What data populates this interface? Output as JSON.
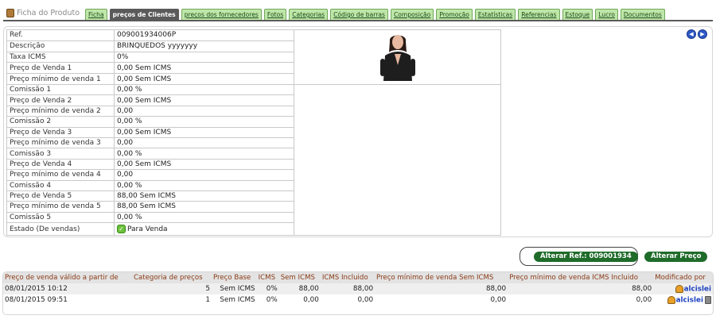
{
  "tabs": {
    "title": "Ficha do Produto",
    "items": [
      {
        "label": "Ficha",
        "active": false
      },
      {
        "label": "preços de Clientes",
        "active": true
      },
      {
        "label": "preços dos fornecedores",
        "active": false
      },
      {
        "label": "Fotos",
        "active": false
      },
      {
        "label": "Categorias",
        "active": false
      },
      {
        "label": "Código de barras",
        "active": false
      },
      {
        "label": "Composição",
        "active": false
      },
      {
        "label": "Promoção",
        "active": false
      },
      {
        "label": "Estatísticas",
        "active": false
      },
      {
        "label": "Referencias",
        "active": false
      },
      {
        "label": "Estoque",
        "active": false
      },
      {
        "label": "Lucro",
        "active": false
      },
      {
        "label": "Documentos",
        "active": false
      }
    ]
  },
  "product": {
    "rows": [
      {
        "label": "Ref.",
        "value": "009001934006P"
      },
      {
        "label": "Descrição",
        "value": "BRINQUEDOS yyyyyyy"
      },
      {
        "label": "Taxa ICMS",
        "value": "0%"
      },
      {
        "label": "Preço de Venda 1",
        "value": "0,00 Sem ICMS"
      },
      {
        "label": "Preço mínimo de venda 1",
        "value": "0,00 Sem ICMS"
      },
      {
        "label": "Comissão 1",
        "value": "0,00 %"
      },
      {
        "label": "Preço de Venda 2",
        "value": "0,00 Sem ICMS"
      },
      {
        "label": "Preço mínimo de venda 2",
        "value": "0,00"
      },
      {
        "label": "Comissão 2",
        "value": "0,00 %"
      },
      {
        "label": "Preço de Venda 3",
        "value": "0,00 Sem ICMS"
      },
      {
        "label": "Preço mínimo de venda 3",
        "value": "0,00"
      },
      {
        "label": "Comissão 3",
        "value": "0,00 %"
      },
      {
        "label": "Preço de Venda 4",
        "value": "0,00 Sem ICMS"
      },
      {
        "label": "Preço mínimo de venda 4",
        "value": "0,00"
      },
      {
        "label": "Comissão 4",
        "value": "0,00 %"
      },
      {
        "label": "Preço de Venda 5",
        "value": "88,00 Sem ICMS"
      },
      {
        "label": "Preço mínimo de venda 5",
        "value": "88,00 Sem ICMS"
      },
      {
        "label": "Comissão 5",
        "value": "0,00 %"
      }
    ],
    "status_label": "Estado (De vendas)",
    "status_value": "Para Venda"
  },
  "actions": {
    "alter_ref": "Alterar Ref.: 009001934",
    "alter_price": "Alterar Preço"
  },
  "prices": {
    "headers": [
      "Preço de venda válido a partir de",
      "Categoria de preços",
      "Preço Base",
      "ICMS",
      "Sem ICMS",
      "ICMS Incluido",
      "Preço mínimo de venda Sem ICMS",
      "Preço mínimo de venda ICMS Incluido",
      "Modificado por"
    ],
    "rows": [
      {
        "date": "08/01/2015 10:12",
        "category": "5",
        "base": "Sem ICMS",
        "icms": "0%",
        "sem": "88,00",
        "incl": "88,00",
        "min_sem": "88,00",
        "min_incl": "88,00",
        "user": "alcislei",
        "trash": false
      },
      {
        "date": "08/01/2015 09:51",
        "category": "1",
        "base": "Sem ICMS",
        "icms": "0%",
        "sem": "0,00",
        "incl": "0,00",
        "min_sem": "0,00",
        "min_incl": "0,00",
        "user": "alcislei",
        "trash": true
      }
    ]
  }
}
